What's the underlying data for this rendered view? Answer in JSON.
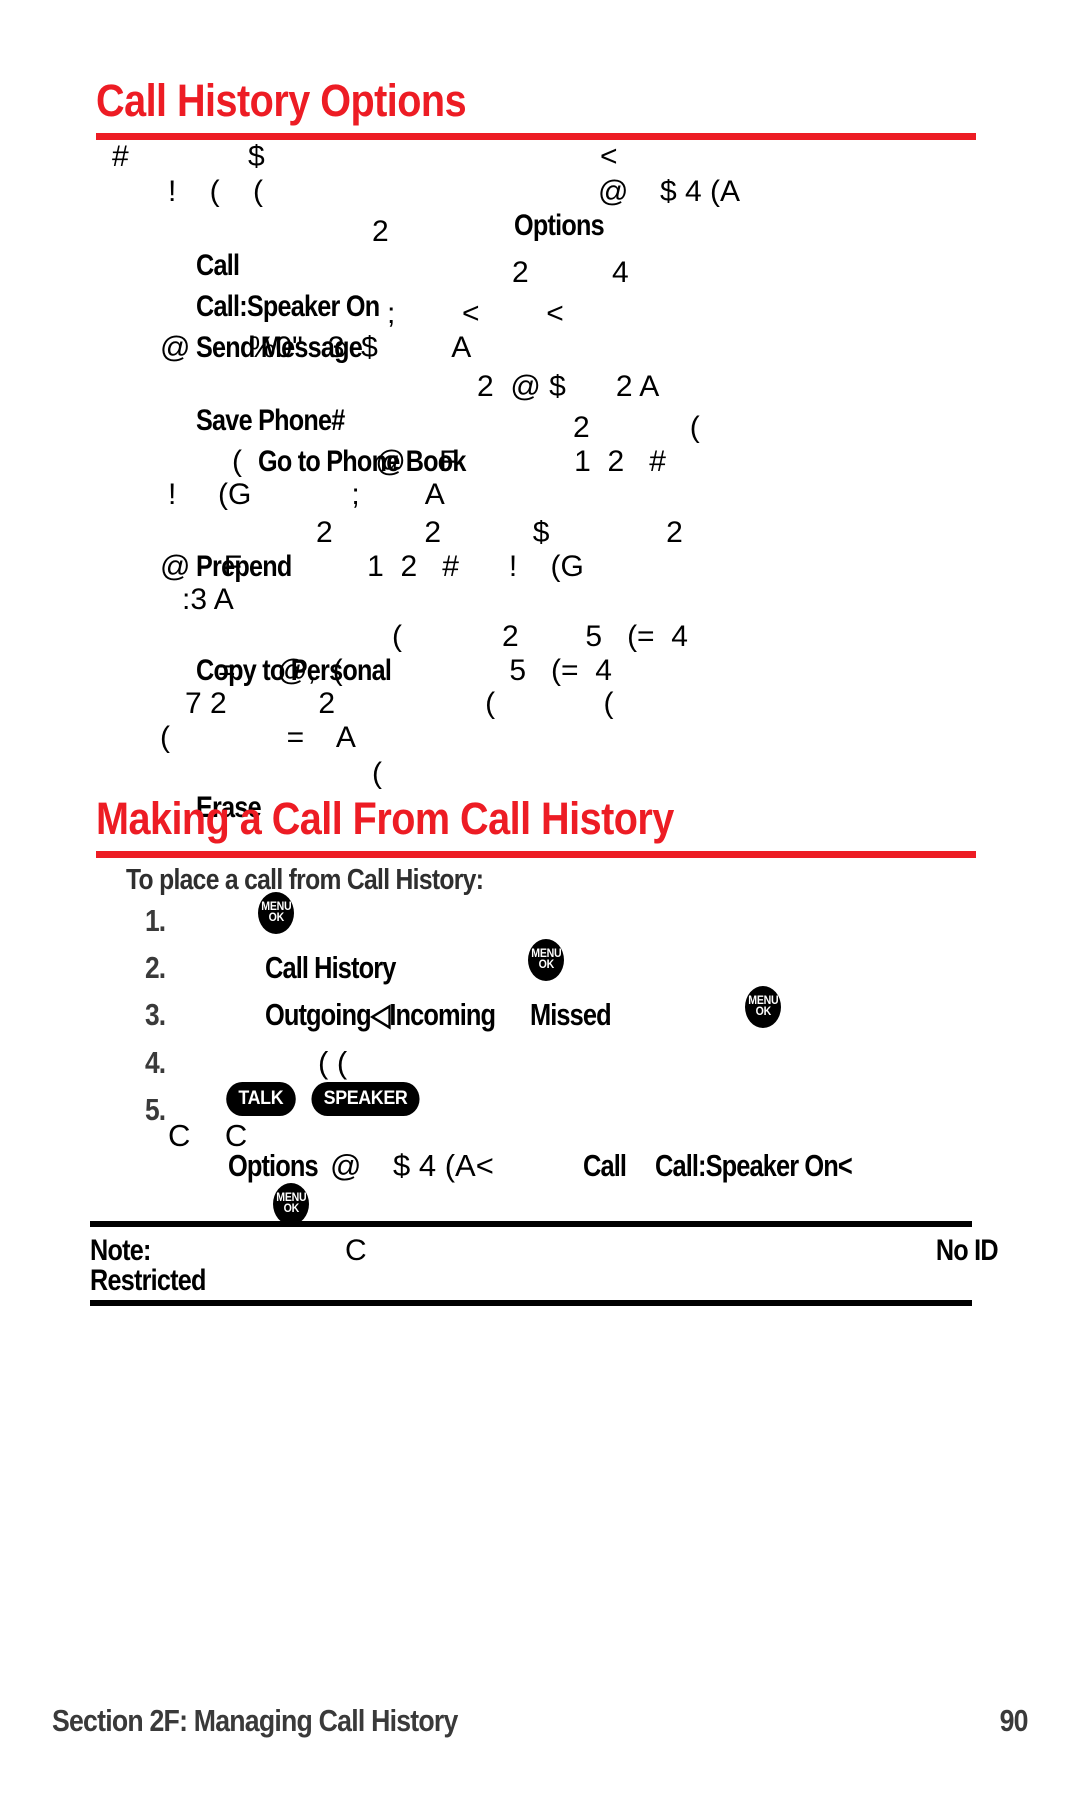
{
  "document": {
    "page_number": "90",
    "footer_section": "Section 2F: Managing Call History"
  },
  "sections": [
    {
      "heading": "Call History Options",
      "heading_color": "#ed1c24"
    },
    {
      "heading": "Making a Call From Call History",
      "heading_color": "#ed1c24"
    }
  ],
  "call_history_options": {
    "intro_lines": [
      {
        "glyphs_a": "#",
        "glyphs_b": "$",
        "glyphs_c": "<"
      },
      {
        "glyphs_a": "!    (    (",
        "term": "Options",
        "glyphs_b": "@",
        "glyphs_c": "$ 4 (A"
      }
    ],
    "options": [
      {
        "term": "Call",
        "lines": [
          {
            "glyphs": "2"
          }
        ]
      },
      {
        "term": "Call:Speaker On",
        "lines": [
          {
            "glyphs": "2          4"
          }
        ]
      },
      {
        "term": "Send Message",
        "lines": [
          {
            "glyphs": ";        <        <"
          },
          {
            "glyphs": "@       %0\"   3  $         A"
          }
        ]
      },
      {
        "term": "Save Phone#",
        "lines": [
          {
            "glyphs": "2  @ $      2 A"
          }
        ]
      },
      {
        "term": "Go to Phone Book",
        "indent": true,
        "lines": [
          {
            "glyphs": "2            ("
          },
          {
            "glyphs": "(                @    F              1  2   #"
          },
          {
            "glyphs": "!     (G            ;        A"
          }
        ]
      },
      {
        "term": "Prepend",
        "lines": [
          {
            "glyphs": "2           2           $              2"
          },
          {
            "glyphs": "@    F               1  2   #      !    (G"
          },
          {
            "glyphs": ":3 A"
          }
        ]
      },
      {
        "term": "Copy to Personal",
        "lines": [
          {
            "glyphs": "(            2        5   (=  4"
          },
          {
            "glyphs": "=     @,  (                    5   (=  4"
          },
          {
            "glyphs": "7 2           2                  (             ("
          },
          {
            "glyphs": "(              =    A"
          }
        ]
      },
      {
        "term": "Erase",
        "lines": [
          {
            "glyphs": "("
          }
        ]
      }
    ]
  },
  "making_a_call": {
    "intro": "To place a call from Call History:",
    "steps": [
      {
        "number": "1.",
        "text": "",
        "icons": [
          "menu-ok-key"
        ]
      },
      {
        "number": "2.",
        "text": "Call History",
        "icons": [
          "menu-ok-key"
        ]
      },
      {
        "number": "3.",
        "text_a": "Outgoing◁Incoming",
        "text_b": "Missed",
        "icons": [
          "menu-ok-key"
        ]
      },
      {
        "number": "4.",
        "glyphs": "( (",
        "icons": []
      },
      {
        "number": "5.",
        "text": "",
        "icons": [
          "talk-key",
          "speaker-key"
        ]
      }
    ],
    "trailing_lines": [
      {
        "glyphs": "C    C"
      },
      {
        "term_a": "Options",
        "glyphs_a": "@",
        "glyphs_b": "$ 4 (A<",
        "term_b": "Call",
        "term_c": "Call:Speaker On<"
      }
    ]
  },
  "note": {
    "label": "Note:",
    "glyphs": "C",
    "right_term": "No ID",
    "second_line_term": "Restricted"
  },
  "keys": {
    "menu_ok": {
      "line1": "MENU",
      "line2": "OK"
    },
    "talk": {
      "label": "TALK"
    },
    "speaker": {
      "label": "SPEAKER"
    }
  }
}
